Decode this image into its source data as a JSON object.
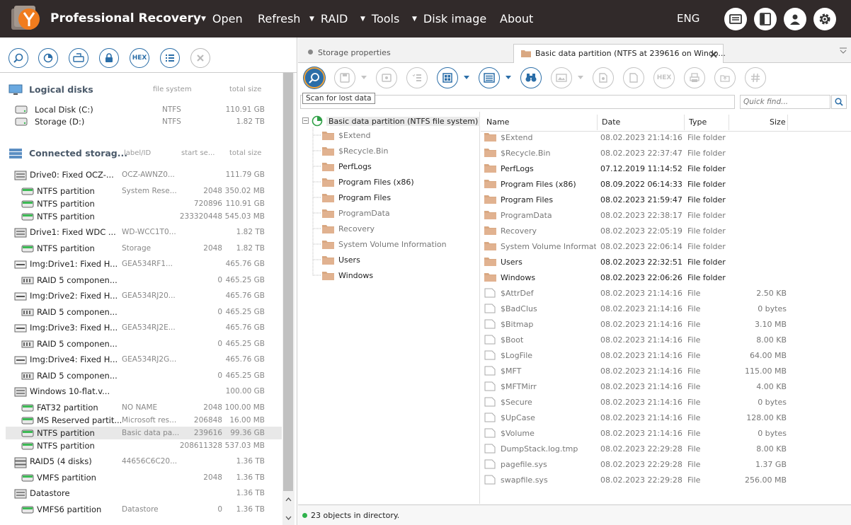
{
  "app": {
    "title": "Professional Recovery",
    "language": "ENG"
  },
  "menu": [
    {
      "label": "Open",
      "dropdown": true
    },
    {
      "label": "Refresh",
      "dropdown": false
    },
    {
      "label": "RAID",
      "dropdown": true
    },
    {
      "label": "Tools",
      "dropdown": true
    },
    {
      "label": "Disk image",
      "dropdown": true
    },
    {
      "label": "About",
      "dropdown": false
    }
  ],
  "left_toolbar": {
    "hex_label": "HEX"
  },
  "logical": {
    "title": "Logical disks",
    "col_fs": "file system",
    "col_size": "total size",
    "items": [
      {
        "name": "Local Disk (C:)",
        "fs": "NTFS",
        "size": "110.91 GB"
      },
      {
        "name": "Storage (D:)",
        "fs": "NTFS",
        "size": "1.82 TB"
      }
    ]
  },
  "connected": {
    "title": "Connected storag...",
    "col_label": "label/ID",
    "col_start": "start se...",
    "col_size": "total size",
    "items": [
      {
        "name": "Drive0: Fixed OCZ-...",
        "label": "OCZ-AWNZ0...",
        "start": "",
        "size": "111.79 GB",
        "kind": "drive"
      },
      {
        "name": "NTFS partition",
        "label": "System Rese...",
        "start": "2048",
        "size": "350.02 MB",
        "kind": "part"
      },
      {
        "name": "NTFS partition",
        "label": "",
        "start": "720896",
        "size": "110.91 GB",
        "kind": "part"
      },
      {
        "name": "NTFS partition",
        "label": "",
        "start": "233320448",
        "size": "545.03 MB",
        "kind": "part"
      },
      {
        "name": "Drive1: Fixed WDC ...",
        "label": "WD-WCC1T0...",
        "start": "",
        "size": "1.82 TB",
        "kind": "drive"
      },
      {
        "name": "NTFS partition",
        "label": "Storage",
        "start": "2048",
        "size": "1.82 TB",
        "kind": "part"
      },
      {
        "name": "Img:Drive1: Fixed H...",
        "label": "GEA534RF1...",
        "start": "",
        "size": "465.76 GB",
        "kind": "img"
      },
      {
        "name": "RAID 5 componen...",
        "label": "",
        "start": "0",
        "size": "465.25 GB",
        "kind": "raidc"
      },
      {
        "name": "Img:Drive2: Fixed H...",
        "label": "GEA534RJ20...",
        "start": "",
        "size": "465.76 GB",
        "kind": "img"
      },
      {
        "name": "RAID 5 componen...",
        "label": "",
        "start": "0",
        "size": "465.25 GB",
        "kind": "raidc"
      },
      {
        "name": "Img:Drive3: Fixed H...",
        "label": "GEA534RJ2E...",
        "start": "",
        "size": "465.76 GB",
        "kind": "img"
      },
      {
        "name": "RAID 5 componen...",
        "label": "",
        "start": "0",
        "size": "465.25 GB",
        "kind": "raidc"
      },
      {
        "name": "Img:Drive4: Fixed H...",
        "label": "GEA534RJ2G...",
        "start": "",
        "size": "465.76 GB",
        "kind": "img"
      },
      {
        "name": "RAID 5 componen...",
        "label": "",
        "start": "0",
        "size": "465.25 GB",
        "kind": "raidc"
      },
      {
        "name": "Windows 10-flat.v...",
        "label": "",
        "start": "",
        "size": "100.00 GB",
        "kind": "drive"
      },
      {
        "name": "FAT32 partition",
        "label": "NO NAME",
        "start": "2048",
        "size": "100.00 MB",
        "kind": "part"
      },
      {
        "name": "MS Reserved partit...",
        "label": "Microsoft res...",
        "start": "206848",
        "size": "16.00 MB",
        "kind": "part"
      },
      {
        "name": "NTFS partition",
        "label": "Basic data pa...",
        "start": "239616",
        "size": "99.36 GB",
        "kind": "part",
        "selected": true
      },
      {
        "name": "NTFS partition",
        "label": "",
        "start": "208611328",
        "size": "537.03 MB",
        "kind": "part"
      },
      {
        "name": "RAID5 (4 disks)",
        "label": "44656C6C20...",
        "start": "",
        "size": "1.36 TB",
        "kind": "raid"
      },
      {
        "name": "VMFS partition",
        "label": "",
        "start": "2048",
        "size": "1.36 TB",
        "kind": "part"
      },
      {
        "name": "Datastore",
        "label": "",
        "start": "",
        "size": "1.36 TB",
        "kind": "drive"
      },
      {
        "name": "VMFS6 partition",
        "label": "Datastore",
        "start": "0",
        "size": "1.36 TB",
        "kind": "part"
      }
    ]
  },
  "tabs": [
    {
      "label": "Storage properties"
    },
    {
      "label": "Basic data partition (NTFS at 239616 on Windo..."
    }
  ],
  "tooltip": "Scan for lost data",
  "search": {
    "placeholder": "Quick find..."
  },
  "tree": {
    "root": "Basic data partition (NTFS file system)",
    "items": [
      {
        "name": "$Extend",
        "meta": true
      },
      {
        "name": "$Recycle.Bin",
        "meta": true
      },
      {
        "name": "PerfLogs",
        "meta": false
      },
      {
        "name": "Program Files (x86)",
        "meta": false
      },
      {
        "name": "Program Files",
        "meta": false
      },
      {
        "name": "ProgramData",
        "meta": true
      },
      {
        "name": "Recovery",
        "meta": true
      },
      {
        "name": "System Volume Information",
        "meta": true
      },
      {
        "name": "Users",
        "meta": false
      },
      {
        "name": "Windows",
        "meta": false
      }
    ]
  },
  "list": {
    "columns": [
      "Name",
      "Date",
      "Type",
      "Size"
    ],
    "rows": [
      {
        "name": "$Extend",
        "date": "08.02.2023 21:14:16",
        "type": "File folder",
        "size": "",
        "folder": true,
        "meta": true
      },
      {
        "name": "$Recycle.Bin",
        "date": "08.02.2023 22:37:47",
        "type": "File folder",
        "size": "",
        "folder": true,
        "meta": true
      },
      {
        "name": "PerfLogs",
        "date": "07.12.2019 11:14:52",
        "type": "File folder",
        "size": "",
        "folder": true,
        "meta": false
      },
      {
        "name": "Program Files (x86)",
        "date": "08.09.2022 06:14:33",
        "type": "File folder",
        "size": "",
        "folder": true,
        "meta": false
      },
      {
        "name": "Program Files",
        "date": "08.02.2023 21:59:47",
        "type": "File folder",
        "size": "",
        "folder": true,
        "meta": false
      },
      {
        "name": "ProgramData",
        "date": "08.02.2023 22:38:17",
        "type": "File folder",
        "size": "",
        "folder": true,
        "meta": true
      },
      {
        "name": "Recovery",
        "date": "08.02.2023 22:05:19",
        "type": "File folder",
        "size": "",
        "folder": true,
        "meta": true
      },
      {
        "name": "System Volume Information",
        "date": "08.02.2023 22:06:14",
        "type": "File folder",
        "size": "",
        "folder": true,
        "meta": true
      },
      {
        "name": "Users",
        "date": "08.02.2023 22:32:51",
        "type": "File folder",
        "size": "",
        "folder": true,
        "meta": false
      },
      {
        "name": "Windows",
        "date": "08.02.2023 22:06:26",
        "type": "File folder",
        "size": "",
        "folder": true,
        "meta": false
      },
      {
        "name": "$AttrDef",
        "date": "08.02.2023 21:14:16",
        "type": "File",
        "size": "2.50 KB",
        "folder": false,
        "meta": true
      },
      {
        "name": "$BadClus",
        "date": "08.02.2023 21:14:16",
        "type": "File",
        "size": "0 bytes",
        "folder": false,
        "meta": true
      },
      {
        "name": "$Bitmap",
        "date": "08.02.2023 21:14:16",
        "type": "File",
        "size": "3.10 MB",
        "folder": false,
        "meta": true
      },
      {
        "name": "$Boot",
        "date": "08.02.2023 21:14:16",
        "type": "File",
        "size": "8.00 KB",
        "folder": false,
        "meta": true
      },
      {
        "name": "$LogFile",
        "date": "08.02.2023 21:14:16",
        "type": "File",
        "size": "64.00 MB",
        "folder": false,
        "meta": true
      },
      {
        "name": "$MFT",
        "date": "08.02.2023 21:14:16",
        "type": "File",
        "size": "115.00 MB",
        "folder": false,
        "meta": true
      },
      {
        "name": "$MFTMirr",
        "date": "08.02.2023 21:14:16",
        "type": "File",
        "size": "4.00 KB",
        "folder": false,
        "meta": true
      },
      {
        "name": "$Secure",
        "date": "08.02.2023 21:14:16",
        "type": "File",
        "size": "0 bytes",
        "folder": false,
        "meta": true
      },
      {
        "name": "$UpCase",
        "date": "08.02.2023 21:14:16",
        "type": "File",
        "size": "128.00 KB",
        "folder": false,
        "meta": true
      },
      {
        "name": "$Volume",
        "date": "08.02.2023 21:14:16",
        "type": "File",
        "size": "0 bytes",
        "folder": false,
        "meta": true
      },
      {
        "name": "DumpStack.log.tmp",
        "date": "08.02.2023 22:29:28",
        "type": "File",
        "size": "8.00 KB",
        "folder": false,
        "meta": true
      },
      {
        "name": "pagefile.sys",
        "date": "08.02.2023 22:29:28",
        "type": "File",
        "size": "1.37 GB",
        "folder": false,
        "meta": true
      },
      {
        "name": "swapfile.sys",
        "date": "08.02.2023 22:29:28",
        "type": "File",
        "size": "256.00 MB",
        "folder": false,
        "meta": true
      }
    ]
  },
  "status": {
    "text": "23 objects in directory."
  },
  "colors": {
    "titlebar": "#312a2a",
    "accent": "#2b6ea8",
    "folder": "#d9a882",
    "status_ok": "#2fb24c",
    "highlight": "#f0a23a"
  },
  "icons": [
    "logo-icon",
    "computer-icon",
    "storage-icon",
    "drive-icon",
    "partition-icon",
    "raid-icon",
    "folder-icon",
    "file-icon",
    "search-icon"
  ]
}
